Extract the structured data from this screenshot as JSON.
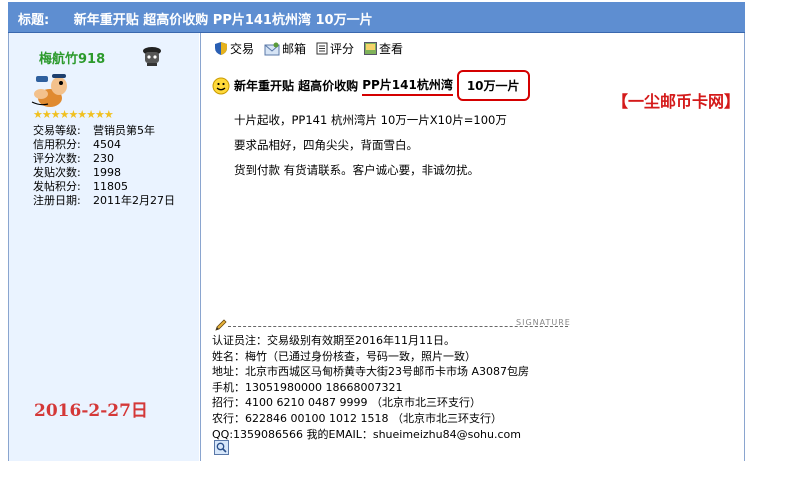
{
  "title_bar": {
    "label": "标题:",
    "text": "新年重开贴 超高价收购 PP片141杭州湾 10万一片"
  },
  "user": {
    "name": "梅航竹918",
    "stars": "★★★★★★★★★",
    "stats": [
      {
        "label": "交易等级:",
        "value": "营销员第5年"
      },
      {
        "label": "信用积分:",
        "value": "4504"
      },
      {
        "label": "评分次数:",
        "value": "230"
      },
      {
        "label": "发贴次数:",
        "value": "1998"
      },
      {
        "label": "发帖积分:",
        "value": "11805"
      },
      {
        "label": "注册日期:",
        "value": "2011年2月27日"
      }
    ]
  },
  "toolbar": {
    "trade": "交易",
    "mail": "邮箱",
    "rate": "评分",
    "view": "查看"
  },
  "post": {
    "title_a": "新年重开贴 超高价收购",
    "title_b": "PP片141杭州湾",
    "title_c": "10万一片",
    "lines": [
      "十片起收，PP141 杭州湾片 10万一片X10片=100万",
      "要求品相好，四角尖尖，背面雪白。",
      "货到付款 有货请联系。客户诚心要，非诚勿扰。"
    ]
  },
  "watermark": "【一尘邮币卡网】",
  "date_annotation": "2016-2-27日",
  "signature": {
    "label": "SIGNATURE",
    "lines": [
      "认证员注：交易级别有效期至2016年11月11日。",
      "姓名：梅竹（已通过身份核查，号码一致，照片一致）",
      "地址：北京市西城区马甸桥黄寺大街23号邮币卡市场 A3087包房",
      "手机：13051980000 18668007321",
      "招行：4100 6210 0487 9999    （北京市北三环支行）",
      "农行：622846 00100 1012 1518 （北京市北三环支行）",
      "QQ:1359086566 我的EMAIL：shueimeizhu84@sohu.com"
    ]
  },
  "colors": {
    "title_bar": "#5e8ed1",
    "left_pane": "#eaf3ff",
    "username": "#2c9a2c",
    "highlight": "#d40000"
  }
}
